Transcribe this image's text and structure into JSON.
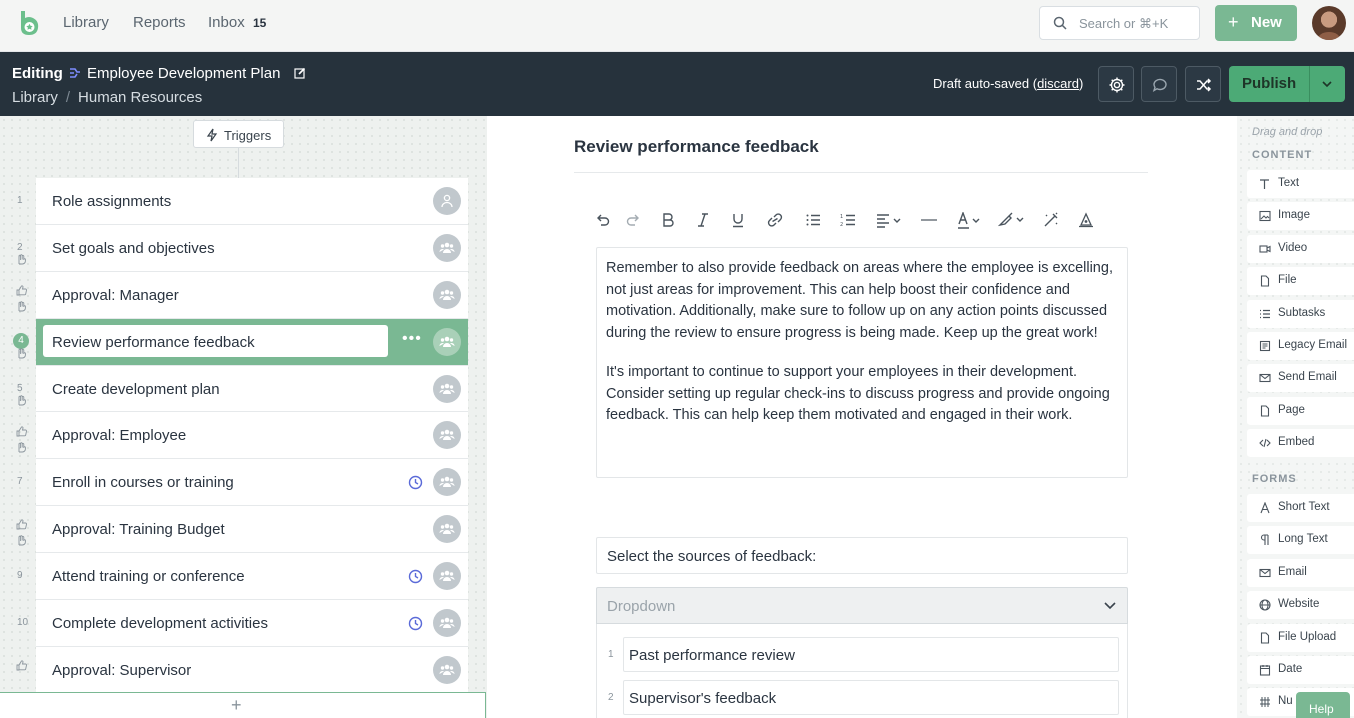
{
  "nav": {
    "links": [
      "Library",
      "Reports",
      "Inbox"
    ],
    "inbox_count": "15",
    "search_placeholder": "Search or ⌘+K",
    "new_label": "New"
  },
  "editbar": {
    "mode": "Editing",
    "title": "Employee Development Plan",
    "breadcrumb": [
      "Library",
      "Human Resources"
    ],
    "draft_text": "Draft auto-saved",
    "discard_label": "discard",
    "publish_label": "Publish"
  },
  "workflow": {
    "triggers_label": "Triggers",
    "steps": [
      {
        "num": "1",
        "name": "Role assignments",
        "clock": false,
        "approval": false,
        "hand": false
      },
      {
        "num": "2",
        "name": "Set goals and objectives",
        "clock": false,
        "approval": false,
        "hand": true
      },
      {
        "num": "",
        "name": "Approval: Manager",
        "clock": false,
        "approval": true,
        "hand": true
      },
      {
        "num": "4",
        "name": "Review performance feedback",
        "clock": false,
        "approval": false,
        "hand": true,
        "active": true
      },
      {
        "num": "5",
        "name": "Create development plan",
        "clock": false,
        "approval": false,
        "hand": true
      },
      {
        "num": "",
        "name": "Approval: Employee",
        "clock": false,
        "approval": true,
        "hand": true
      },
      {
        "num": "7",
        "name": "Enroll in courses or training",
        "clock": true,
        "approval": false,
        "hand": false
      },
      {
        "num": "",
        "name": "Approval: Training Budget",
        "clock": false,
        "approval": true,
        "hand": true
      },
      {
        "num": "9",
        "name": "Attend training or conference",
        "clock": true,
        "approval": false,
        "hand": false
      },
      {
        "num": "10",
        "name": "Complete development activities",
        "clock": true,
        "approval": false,
        "hand": false
      },
      {
        "num": "",
        "name": "Approval: Supervisor",
        "clock": false,
        "approval": true,
        "hand": false
      }
    ],
    "add_label": "+"
  },
  "editor": {
    "task_title": "Review performance feedback",
    "paragraphs": [
      "Remember to also provide feedback on areas where the employee is excelling, not just areas for improvement. This can help boost their confidence and motivation. Additionally, make sure to follow up on any action points discussed during the review to ensure progress is being made. Keep up the great work!",
      "It's important to continue to support your employees in their development. Consider setting up regular check-ins to discuss progress and provide ongoing feedback. This can help keep them motivated and engaged in their work."
    ],
    "form_label": "Select the sources of feedback:",
    "dropdown_label": "Dropdown",
    "options": [
      {
        "num": "1",
        "value": "Past performance review"
      },
      {
        "num": "2",
        "value": "Supervisor's feedback"
      }
    ]
  },
  "sidebar": {
    "hint": "Drag and drop",
    "content_title": "CONTENT",
    "content_items": [
      "Text",
      "Image",
      "Video",
      "File",
      "Subtasks",
      "Legacy Email",
      "Send Email",
      "Page",
      "Embed"
    ],
    "forms_title": "FORMS",
    "form_items": [
      "Short Text",
      "Long Text",
      "Email",
      "Website",
      "File Upload",
      "Date",
      "Nu"
    ]
  },
  "help_label": "Help",
  "colors": {
    "accent": "#7ab893",
    "dark": "#26323c",
    "publish": "#4caa76"
  }
}
